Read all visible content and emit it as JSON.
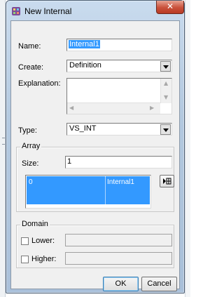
{
  "window": {
    "title": "New Internal",
    "close_glyph": "✕",
    "app_icon": "app-icon"
  },
  "fields": {
    "name_label": "Name:",
    "name_value": "Internal1",
    "create_label": "Create:",
    "create_value": "Definition",
    "explanation_label": "Explanation:",
    "explanation_value": "",
    "type_label": "Type:",
    "type_value": "VS_INT"
  },
  "array": {
    "title": "Array",
    "size_label": "Size:",
    "size_value": "1",
    "rows": [
      {
        "index": "0",
        "value": "Internal1"
      }
    ],
    "edit_button_icon": "edit-icon"
  },
  "domain": {
    "title": "Domain",
    "lower_label": "Lower:",
    "lower_value": "",
    "higher_label": "Higher:",
    "higher_value": ""
  },
  "buttons": {
    "ok": "OK",
    "cancel": "Cancel"
  },
  "colors": {
    "selection": "#3399ff",
    "close_button": "#c9503a",
    "frame": "#b3c9e0"
  }
}
